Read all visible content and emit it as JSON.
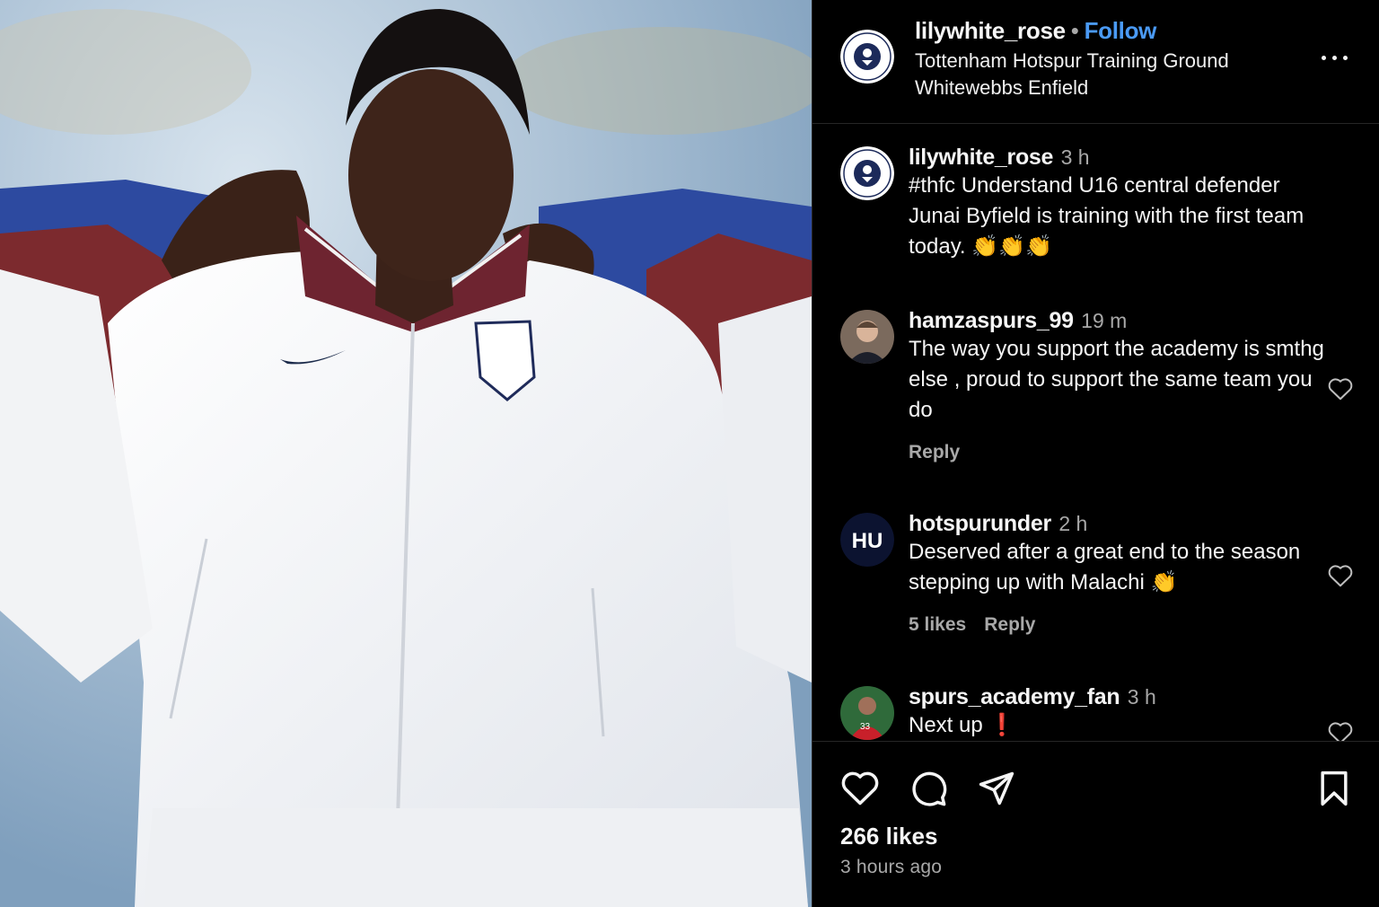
{
  "post": {
    "image_alt": "Player in white England training jacket",
    "author": "lilywhite_rose",
    "separator": "•",
    "follow_label": "Follow",
    "location": "Tottenham Hotspur Training Ground Whitewebbs Enfield",
    "more_icon": "more-horizontal-icon"
  },
  "caption": {
    "user": "lilywhite_rose",
    "time": "3 h",
    "text": "#thfc Understand U16 central defender Junai Byfield is training with the first team today. 👏👏👏"
  },
  "comments": [
    {
      "user": "hamzaspurs_99",
      "time": "19 m",
      "text": "The way you support the academy is smthg else , proud to support the same team you do",
      "likes": "",
      "reply_label": "Reply"
    },
    {
      "user": "hotspurunder",
      "time": "2 h",
      "text": "Deserved after a great end to the season stepping up with Malachi 👏",
      "likes": "5 likes",
      "reply_label": "Reply",
      "avatar_text": "HU"
    },
    {
      "user": "spurs_academy_fan",
      "time": "3 h",
      "text": "Next up",
      "emoji": "❗"
    }
  ],
  "actions": {
    "like_icon": "heart-icon",
    "comment_icon": "comment-icon",
    "share_icon": "send-icon",
    "save_icon": "bookmark-icon"
  },
  "stats": {
    "likes": "266 likes",
    "time_ago": "3 hours ago"
  },
  "colors": {
    "background": "#000000",
    "follow": "#4a9af5",
    "muted": "#a8a8a8",
    "divider": "#262626"
  }
}
